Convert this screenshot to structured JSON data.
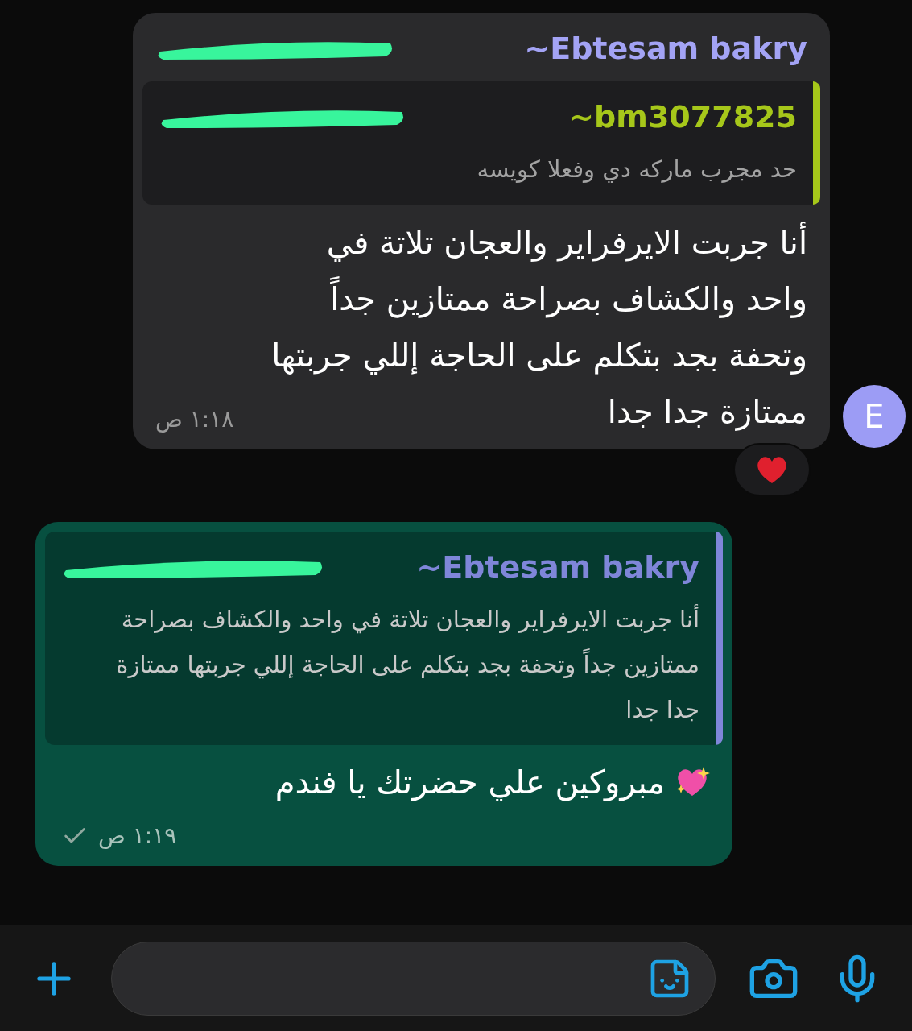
{
  "messages": [
    {
      "kind": "incoming",
      "sender": "~Ebtesam bakry",
      "color": "#a3a3f5",
      "avatar": "E",
      "quote": {
        "sender": "~bm3077825",
        "color": "#a6c71a",
        "text": "حد مجرب ماركه دي وفعلا كويسه"
      },
      "text": "أنا جربت الايرفراير والعجان تلاتة في واحد والكشاف بصراحة ممتازين جداً وتحفة بجد بتكلم على الحاجة إللي جربتها ممتازة جدا جدا",
      "time": "١:١٨ ص",
      "heart_reaction": true
    },
    {
      "kind": "outgoing",
      "quote": {
        "sender": "~Ebtesam bakry",
        "color": "#7f86d9",
        "text": "أنا جربت الايرفراير والعجان تلاتة في واحد والكشاف بصراحة ممتازين جداً وتحفة بجد بتكلم على الحاجة إللي جربتها ممتازة جدا جدا"
      },
      "text": "مبروكين علي حضرتك يا فندم",
      "time": "١:١٩ ص",
      "read": false
    }
  ],
  "composer": {
    "kind": "input"
  }
}
